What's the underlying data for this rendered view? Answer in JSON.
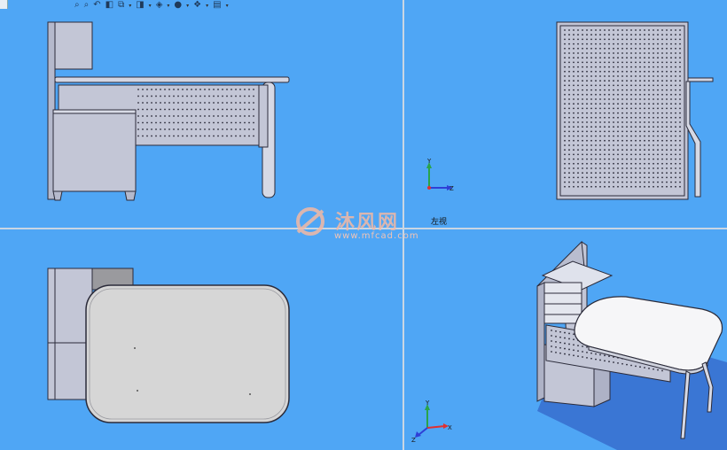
{
  "toolbar": {
    "items": [
      {
        "name": "zoom-to-fit",
        "glyph": "⌕"
      },
      {
        "name": "zoom-area",
        "glyph": "⌕"
      },
      {
        "name": "previous-view",
        "glyph": "↶"
      },
      {
        "name": "section-view",
        "glyph": "◧"
      },
      {
        "name": "view-orientation",
        "glyph": "⧉"
      },
      {
        "name": "display-style",
        "glyph": "◨"
      },
      {
        "name": "hide-show",
        "glyph": "◈"
      },
      {
        "name": "edit-appearance",
        "glyph": "●"
      },
      {
        "name": "apply-scene",
        "glyph": "❖"
      },
      {
        "name": "view-settings",
        "glyph": "▤"
      }
    ]
  },
  "viewports": {
    "right_view_label": "左视"
  },
  "triad": {
    "x": "X",
    "y": "Y",
    "z": "Z"
  },
  "watermark": {
    "brand": "沐风网",
    "url": "www.mfcad.com"
  },
  "colors": {
    "background": "#4fa6f5",
    "part_fill": "#c3c6d6",
    "part_edge": "#2b2b3a",
    "triad_x": "#e03030",
    "triad_y": "#2aa34a",
    "triad_z": "#2f3fd6"
  }
}
